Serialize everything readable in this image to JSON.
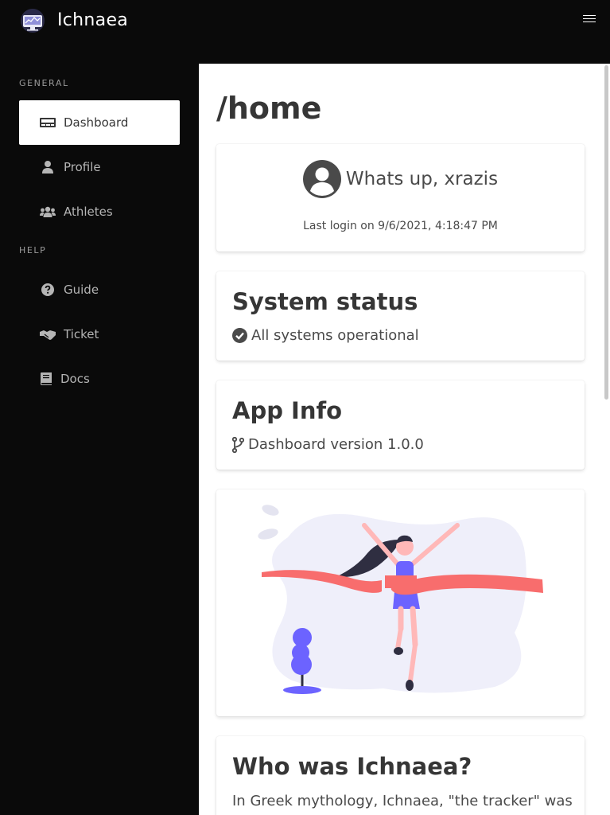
{
  "app": {
    "title": "Ichnaea"
  },
  "sidebar": {
    "sections": [
      {
        "label": "GENERAL"
      },
      {
        "label": "HELP"
      }
    ],
    "items": [
      {
        "label": "Dashboard",
        "icon": "dashboard-icon"
      },
      {
        "label": "Profile",
        "icon": "user-icon"
      },
      {
        "label": "Athletes",
        "icon": "users-icon"
      },
      {
        "label": "Guide",
        "icon": "question-circle-icon"
      },
      {
        "label": "Ticket",
        "icon": "handshake-icon"
      },
      {
        "label": "Docs",
        "icon": "book-icon"
      }
    ]
  },
  "main": {
    "title": "/home",
    "greeting": {
      "text": "Whats up, xrazis",
      "last_login": "Last login on 9/6/2021, 4:18:47 PM"
    },
    "status": {
      "heading": "System status",
      "text": "All systems operational"
    },
    "info": {
      "heading": "App Info",
      "text": "Dashboard version 1.0.0"
    },
    "who": {
      "heading": "Who was Ichnaea?",
      "text": "In Greek mythology, Ichnaea, \"the tracker\" was an epithet that could be applied to Themis"
    }
  },
  "colors": {
    "background": "#0a0a0a",
    "panel": "#ffffff",
    "accent": "#6c63ff",
    "ribbon": "#f86d6d",
    "text": "#363636"
  }
}
